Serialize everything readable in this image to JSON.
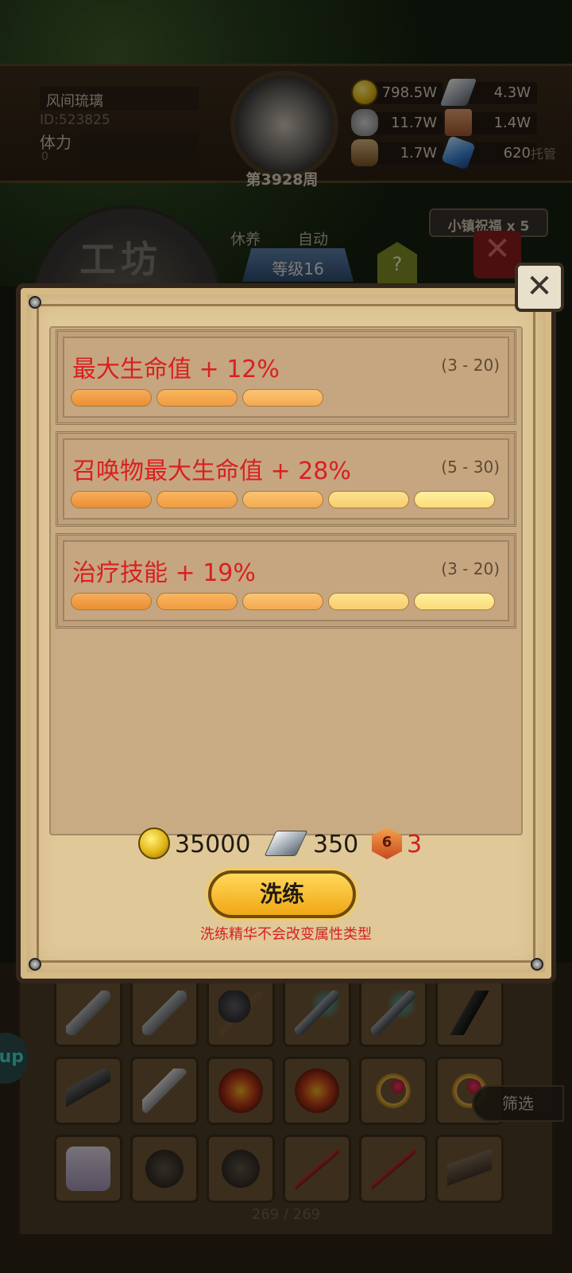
{
  "hud": {
    "player_name": "风间琉璃",
    "player_id": "ID:523825",
    "stamina_label": "体力",
    "stamina_value": "0",
    "week": "第3928周",
    "resources": [
      {
        "icon": "gold-coin-icon",
        "value": "798.5W"
      },
      {
        "icon": "silver-ingot-icon",
        "value": "4.3W"
      },
      {
        "icon": "ore-icon",
        "value": "11.7W"
      },
      {
        "icon": "hide-icon",
        "value": "1.4W"
      },
      {
        "icon": "wood-icon",
        "value": "1.7W"
      },
      {
        "icon": "crystal-icon",
        "value": "620"
      }
    ],
    "trust_label": "托管"
  },
  "workshop": {
    "title": "工坊",
    "menu_rest": "休养",
    "menu_auto": "自动",
    "level": "等级16",
    "help": "?",
    "blessing": "小镇祝福 x 5"
  },
  "modal": {
    "attributes": [
      {
        "name": "最大生命值 + 12%",
        "range": "(3 - 20)",
        "bars": 3
      },
      {
        "name": "召唤物最大生命值 + 28%",
        "range": "(5 - 30)",
        "bars": 5
      },
      {
        "name": "治疗技能 + 19%",
        "range": "(3 - 20)",
        "bars": 5
      }
    ],
    "cost": {
      "gold": "35000",
      "silver": "350",
      "essence_icon_label": "6",
      "essence": "3"
    },
    "refine_button": "洗练",
    "refine_note": "洗练精华不会改变属性类型"
  },
  "inventory": {
    "filter_label": "筛选",
    "side_tab": "up",
    "page_count": "269 / 269",
    "items": [
      "rifle-icon",
      "rifle-icon",
      "axe-icon",
      "spear-icon",
      "spear-icon",
      "claw-icon",
      "blade-icon",
      "saber-icon",
      "flame-weapon-icon",
      "flame-weapon-icon",
      "ring-icon",
      "ring-icon",
      "medkit-icon",
      "helmet-icon",
      "helmet-icon",
      "katana-icon",
      "katana-icon",
      "pistol-icon"
    ]
  },
  "colors": {
    "attribute_text": "#d82020",
    "button_gold": "#f0a715",
    "panel_bg": "#c9ab83"
  }
}
